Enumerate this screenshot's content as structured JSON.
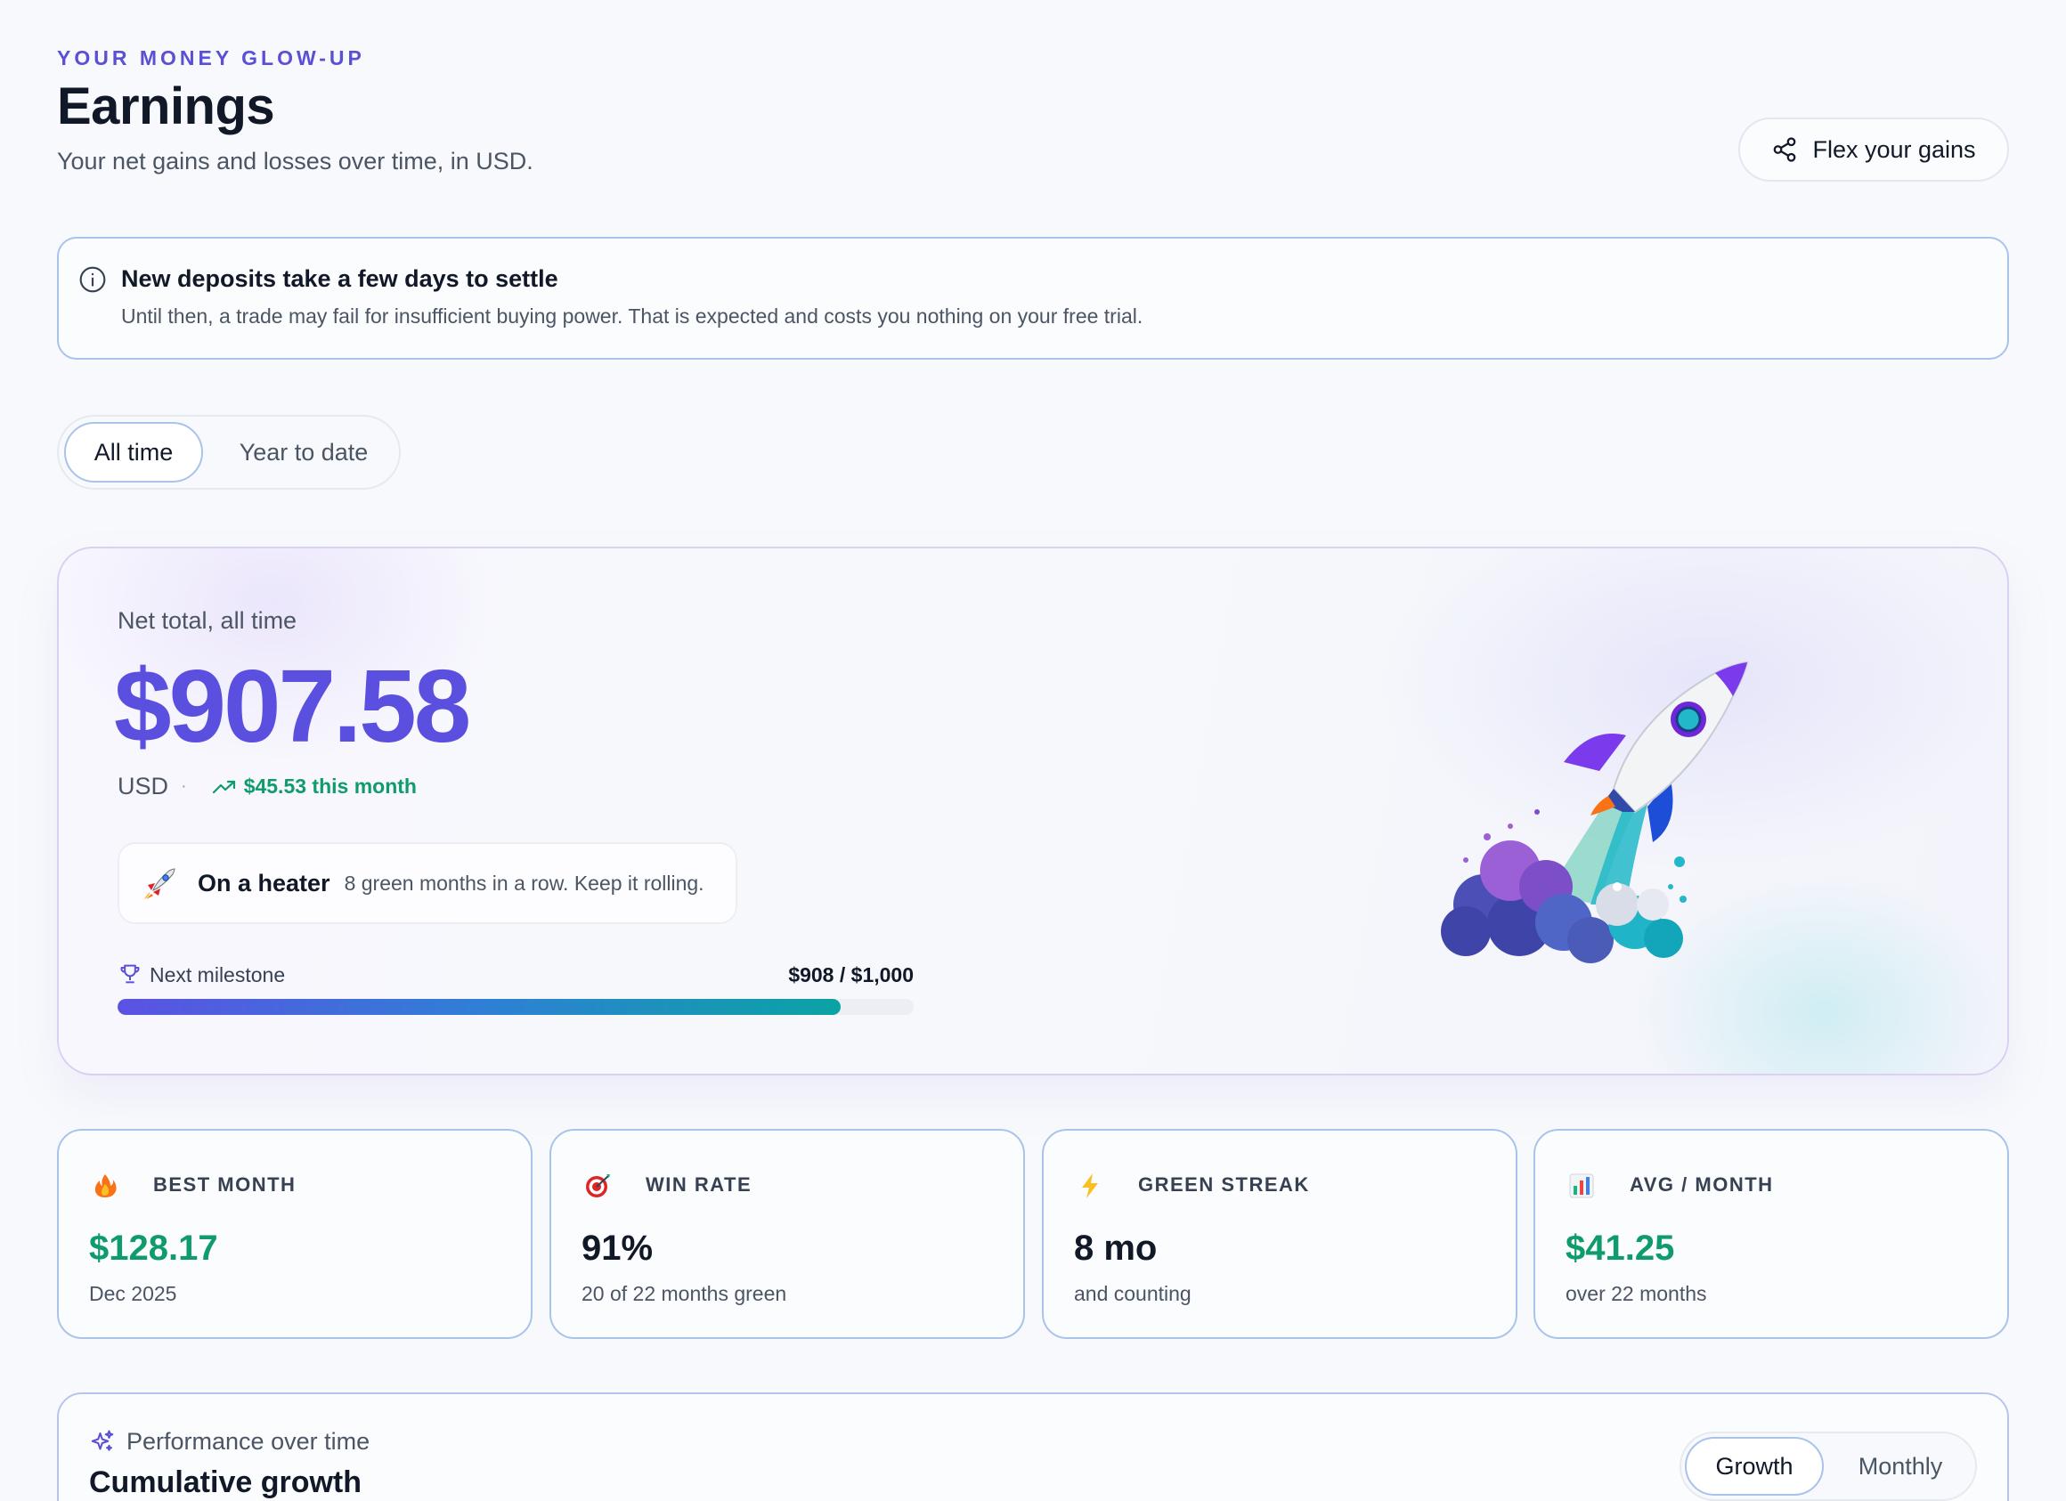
{
  "header": {
    "eyebrow": "YOUR MONEY GLOW-UP",
    "title": "Earnings",
    "subtitle": "Your net gains and losses over time, in USD.",
    "share_button": "Flex your gains"
  },
  "notice": {
    "title": "New deposits take a few days to settle",
    "body": "Until then, a trade may fail for insufficient buying power. That is expected and costs you nothing on your free trial."
  },
  "range_tabs": {
    "active": "All time",
    "inactive": "Year to date"
  },
  "hero": {
    "label": "Net total, all time",
    "amount": "$907.58",
    "currency": "USD",
    "separator": "·",
    "delta": "$45.53 this month",
    "streak_title": "On a heater",
    "streak_text": "8 green months in a row. Keep it rolling.",
    "milestone_label": "Next milestone",
    "milestone_value": "$908 / $1,000",
    "milestone_progress": 0.908
  },
  "stats": [
    {
      "icon": "fire-icon",
      "label": "BEST MONTH",
      "value": "$128.17",
      "sub": "Dec 2025",
      "tone": "green"
    },
    {
      "icon": "target-icon",
      "label": "WIN RATE",
      "value": "91%",
      "sub": "20 of 22 months green",
      "tone": "dark"
    },
    {
      "icon": "lightning-icon",
      "label": "GREEN STREAK",
      "value": "8 mo",
      "sub": "and counting",
      "tone": "dark"
    },
    {
      "icon": "bar-chart-icon",
      "label": "AVG / MONTH",
      "value": "$41.25",
      "sub": "over 22 months",
      "tone": "green"
    }
  ],
  "performance": {
    "eyebrow": "Performance over time",
    "title": "Cumulative growth",
    "tabs": {
      "active": "Growth",
      "inactive": "Monthly"
    }
  },
  "colors": {
    "accent": "#5b4fe0",
    "positive": "#0f9b6b",
    "card_border": "#a9c3ea"
  }
}
